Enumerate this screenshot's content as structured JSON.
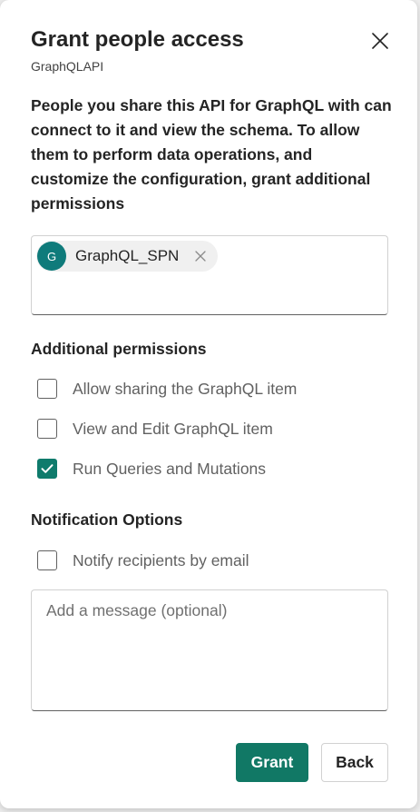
{
  "dialog": {
    "title": "Grant people access",
    "subtitle": "GraphQLAPI",
    "close_icon": "close-icon",
    "description": "People you share this API for GraphQL with can connect to it and view the schema. To allow them to perform data operations, and customize the configuration, grant additional permissions"
  },
  "recipients": [
    {
      "initial": "G",
      "name": "GraphQL_SPN",
      "avatar_color": "#0f7b7b",
      "remove_icon": "dismiss-icon"
    }
  ],
  "additional_permissions": {
    "heading": "Additional permissions",
    "options": [
      {
        "label": "Allow sharing the GraphQL item",
        "checked": false
      },
      {
        "label": "View and Edit GraphQL item",
        "checked": false
      },
      {
        "label": "Run Queries and Mutations",
        "checked": true
      }
    ]
  },
  "notification": {
    "heading": "Notification Options",
    "notify_label": "Notify recipients by email",
    "notify_checked": false,
    "message_placeholder": "Add a message (optional)",
    "message_value": ""
  },
  "actions": {
    "grant_label": "Grant",
    "back_label": "Back"
  },
  "colors": {
    "accent": "#117865",
    "checkbox_checked": "#0f7b6c"
  }
}
